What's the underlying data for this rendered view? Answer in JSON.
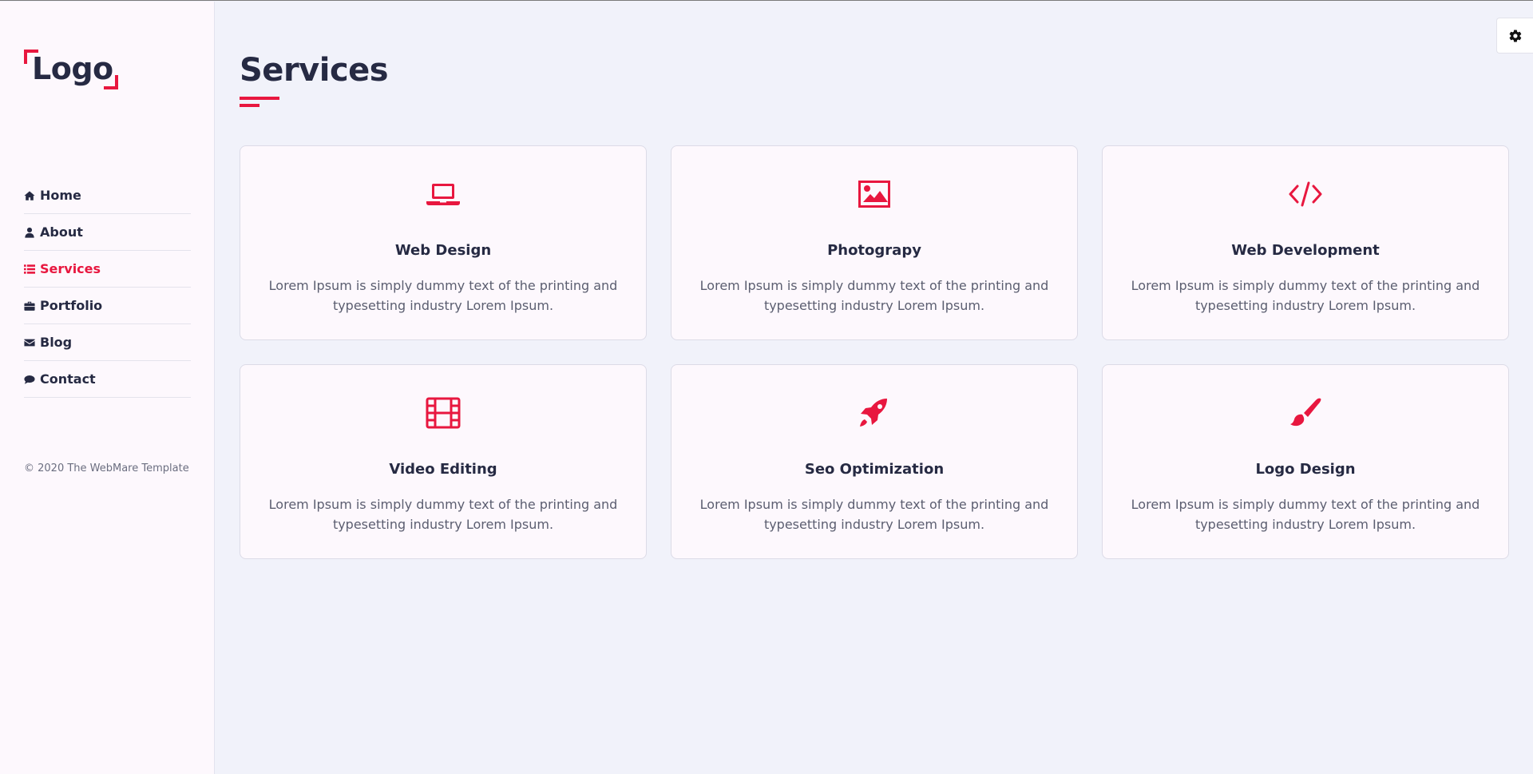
{
  "logo": {
    "text": "Logo"
  },
  "nav": {
    "items": [
      {
        "label": "Home",
        "icon": "home-icon"
      },
      {
        "label": "About",
        "icon": "user-icon"
      },
      {
        "label": "Services",
        "icon": "list-icon",
        "active": true
      },
      {
        "label": "Portfolio",
        "icon": "briefcase-icon"
      },
      {
        "label": "Blog",
        "icon": "envelope-icon"
      },
      {
        "label": "Contact",
        "icon": "comments-icon"
      }
    ]
  },
  "footer": {
    "copyright": "© 2020 The WebMare Template"
  },
  "page": {
    "title": "Services"
  },
  "services": [
    {
      "title": "Web Design",
      "icon": "laptop-icon",
      "text": "Lorem Ipsum is simply dummy text of the printing and typesetting industry Lorem Ipsum."
    },
    {
      "title": "Photograpy",
      "icon": "image-icon",
      "text": "Lorem Ipsum is simply dummy text of the printing and typesetting industry Lorem Ipsum."
    },
    {
      "title": "Web Development",
      "icon": "code-icon",
      "text": "Lorem Ipsum is simply dummy text of the printing and typesetting industry Lorem Ipsum."
    },
    {
      "title": "Video Editing",
      "icon": "film-icon",
      "text": "Lorem Ipsum is simply dummy text of the printing and typesetting industry Lorem Ipsum."
    },
    {
      "title": "Seo Optimization",
      "icon": "rocket-icon",
      "text": "Lorem Ipsum is simply dummy text of the printing and typesetting industry Lorem Ipsum."
    },
    {
      "title": "Logo Design",
      "icon": "paint-brush-icon",
      "text": "Lorem Ipsum is simply dummy text of the printing and typesetting industry Lorem Ipsum."
    }
  ],
  "settings": {
    "icon": "gear-icon"
  },
  "colors": {
    "accent": "#e8173f",
    "text": "#262a43",
    "background": "#f1f2fa",
    "sidebar": "#fdf8fd"
  }
}
